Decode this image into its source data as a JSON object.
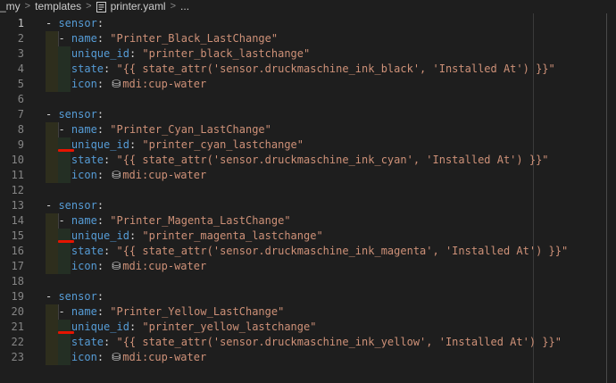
{
  "breadcrumb": {
    "folder1": "_my",
    "folder2": "templates",
    "file": "printer.yaml",
    "more": "..."
  },
  "editor": {
    "active_line": 1,
    "lines": [
      {
        "n": "1",
        "indent": 0,
        "kind": "top",
        "text": "sensor:"
      },
      {
        "n": "2",
        "indent": 1,
        "kind": "item",
        "key": "name",
        "value": "\"Printer_Black_LastChange\""
      },
      {
        "n": "3",
        "indent": 2,
        "kind": "kv",
        "key": "unique_id",
        "value": "\"printer_black_lastchange\""
      },
      {
        "n": "4",
        "indent": 2,
        "kind": "kv",
        "key": "state",
        "value": "\"{{ state_attr('sensor.druckmaschine_ink_black', 'Installed At') }}\""
      },
      {
        "n": "5",
        "indent": 2,
        "kind": "icon",
        "key": "icon",
        "value": "mdi:cup-water"
      },
      {
        "n": "6",
        "indent": 0,
        "kind": "empty"
      },
      {
        "n": "7",
        "indent": 0,
        "kind": "top",
        "text": "sensor:"
      },
      {
        "n": "8",
        "indent": 1,
        "kind": "item",
        "key": "name",
        "value": "\"Printer_Cyan_LastChange\""
      },
      {
        "n": "9",
        "indent": 2,
        "kind": "kv",
        "key": "unique_id",
        "value": "\"printer_cyan_lastchange\"",
        "error": true
      },
      {
        "n": "10",
        "indent": 2,
        "kind": "kv",
        "key": "state",
        "value": "\"{{ state_attr('sensor.druckmaschine_ink_cyan', 'Installed At') }}\""
      },
      {
        "n": "11",
        "indent": 2,
        "kind": "icon",
        "key": "icon",
        "value": "mdi:cup-water"
      },
      {
        "n": "12",
        "indent": 0,
        "kind": "empty"
      },
      {
        "n": "13",
        "indent": 0,
        "kind": "top",
        "text": "sensor:"
      },
      {
        "n": "14",
        "indent": 1,
        "kind": "item",
        "key": "name",
        "value": "\"Printer_Magenta_LastChange\""
      },
      {
        "n": "15",
        "indent": 2,
        "kind": "kv",
        "key": "unique_id",
        "value": "\"printer_magenta_lastchange\"",
        "error": true
      },
      {
        "n": "16",
        "indent": 2,
        "kind": "kv",
        "key": "state",
        "value": "\"{{ state_attr('sensor.druckmaschine_ink_magenta', 'Installed At') }}\""
      },
      {
        "n": "17",
        "indent": 2,
        "kind": "icon",
        "key": "icon",
        "value": "mdi:cup-water"
      },
      {
        "n": "18",
        "indent": 0,
        "kind": "empty"
      },
      {
        "n": "19",
        "indent": 0,
        "kind": "top",
        "text": "sensor:"
      },
      {
        "n": "20",
        "indent": 1,
        "kind": "item",
        "key": "name",
        "value": "\"Printer_Yellow_LastChange\""
      },
      {
        "n": "21",
        "indent": 2,
        "kind": "kv",
        "key": "unique_id",
        "value": "\"printer_yellow_lastchange\"",
        "error": true
      },
      {
        "n": "22",
        "indent": 2,
        "kind": "kv",
        "key": "state",
        "value": "\"{{ state_attr('sensor.druckmaschine_ink_yellow', 'Installed At') }}\""
      },
      {
        "n": "23",
        "indent": 2,
        "kind": "icon",
        "key": "icon",
        "value": "mdi:cup-water"
      }
    ]
  },
  "colors": {
    "background": "#1e1e1e",
    "key": "#569cd6",
    "string": "#ce9178",
    "error": "#e51400"
  }
}
